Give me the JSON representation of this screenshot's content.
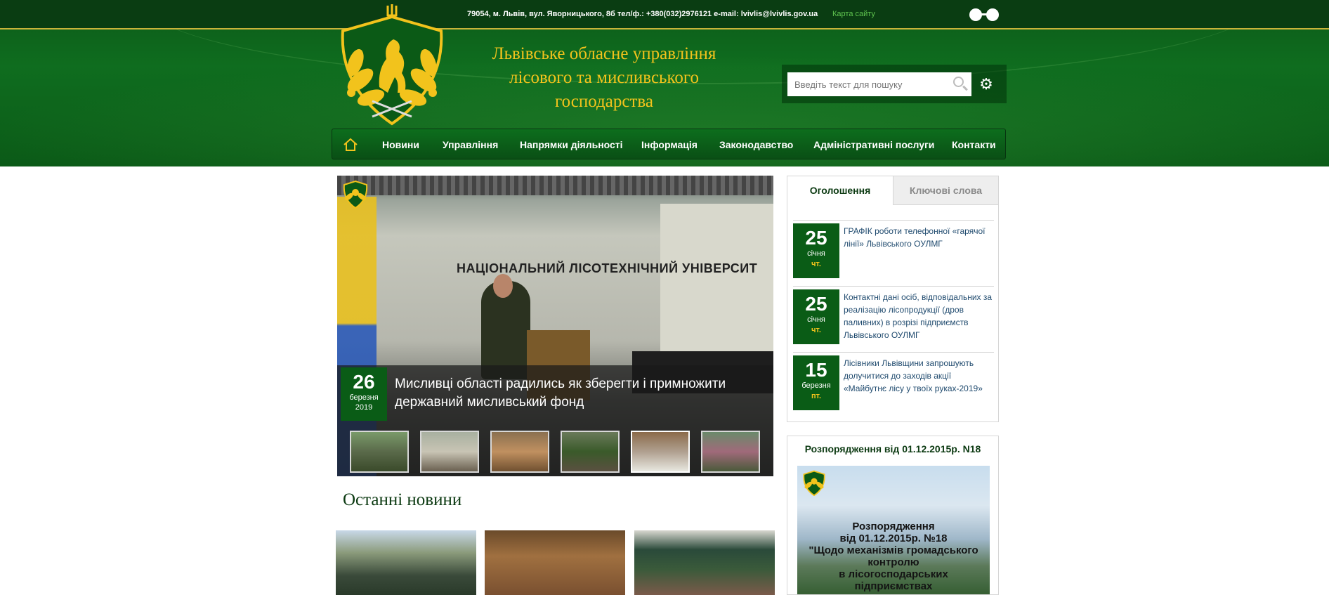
{
  "topbar": {
    "contacts": "79054, м. Львів, вул. Яворницького, 8б тел/ф.: +380(032)2976121 e-mail: lvivlis@lvivlis.gov.ua",
    "sitemap": "Карта сайту"
  },
  "header": {
    "title_lines": [
      "Львівське обласне управління",
      "лісового та мисливського",
      "господарства"
    ]
  },
  "search": {
    "placeholder": "Введіть текст для пошуку"
  },
  "nav": {
    "items": [
      "Новини",
      "Управління",
      "Напрямки діяльності",
      "Інформація",
      "Законодавство",
      "Адміністративні послуги",
      "Контакти"
    ]
  },
  "slider": {
    "day": "26",
    "month": "березня",
    "year": "2019",
    "title": "Мисливці області радились як зберегти і примножити державний мисливський фонд",
    "banner_text": "НАЦІОНАЛЬНИЙ ЛІСОТЕХНІЧНИЙ УНІВЕРСИТ"
  },
  "latest": {
    "title": "Останні новини"
  },
  "sidebar": {
    "tabs": [
      "Оголошення",
      "Ключові слова"
    ],
    "announcements": [
      {
        "day": "25",
        "month": "січня",
        "weekday": "чт.",
        "text": "ГРАФІК роботи телефонної «гарячої лінії» Львівського ОУЛМГ"
      },
      {
        "day": "25",
        "month": "січня",
        "weekday": "чт.",
        "text": "Контактні дані осіб, відповідальних за реалізацію лісопродукції (дров паливних) в розрізі підприємств Львівського ОУЛМГ"
      },
      {
        "day": "15",
        "month": "березня",
        "weekday": "пт.",
        "text": "Лісівники Львівщини запрошують долучитися до заходів акції «Майбутнє лісу у твоїх руках-2019»"
      }
    ],
    "decree": {
      "title": "Розпорядження від 01.12.2015р. N18",
      "image_text": [
        "Розпорядження",
        "від 01.12.2015р. №18",
        "\"Щодо механізмів громадського",
        "контролю",
        "в лісогосподарських",
        "підприємствах"
      ]
    }
  },
  "colors": {
    "brand_green": "#0a5c16",
    "accent_gold": "#f2c31c",
    "link_blue": "#1f4a6e"
  }
}
